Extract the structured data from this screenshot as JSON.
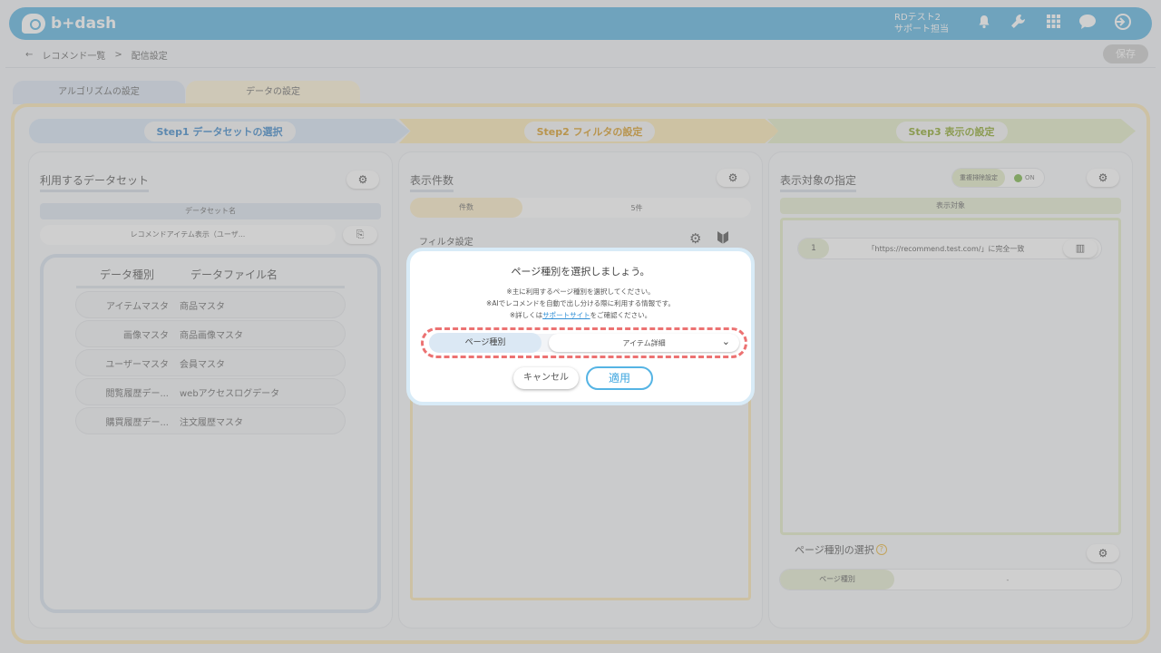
{
  "header": {
    "logo_text": "b+dash",
    "user_line1": "RDテスト2",
    "user_line2": "サポート担当",
    "icons": [
      "bell-icon",
      "wrench-icon",
      "grid-icon",
      "chat-icon",
      "logout-icon"
    ]
  },
  "breadcrumb": {
    "back": "←",
    "item1": "レコメンド一覧",
    "sep": ">",
    "item2": "配信設定"
  },
  "save_label": "保存",
  "tabs": {
    "algorithm": "アルゴリズムの設定",
    "data": "データの設定"
  },
  "steps": {
    "step1": "Step1 データセットの選択",
    "step2": "Step2 フィルタの設定",
    "step3": "Step3 表示の設定"
  },
  "dataset_panel": {
    "title": "利用するデータセット",
    "name_header": "データセット名",
    "name_value": "レコメンドアイテム表示（ユーザ...",
    "table_head_type": "データ種別",
    "table_head_file": "データファイル名",
    "rows": [
      {
        "type": "アイテムマスタ",
        "file": "商品マスタ"
      },
      {
        "type": "画像マスタ",
        "file": "商品画像マスタ"
      },
      {
        "type": "ユーザーマスタ",
        "file": "会員マスタ"
      },
      {
        "type": "閲覧履歴デー...",
        "file": "webアクセスログデータ"
      },
      {
        "type": "購買履歴デー...",
        "file": "注文履歴マスタ"
      }
    ]
  },
  "display_panel": {
    "title": "表示件数",
    "count_key": "件数",
    "count_value": "5件",
    "filter_title": "フィルタ設定"
  },
  "target_panel": {
    "title": "表示対象の指定",
    "dedupe_label": "重複排除設定",
    "toggle_value": "ON",
    "target_header": "表示対象",
    "target_num": "1",
    "target_value": "「https://recommend.test.com/」に完全一致",
    "pagetype_title": "ページ種別の選択",
    "pagetype_key": "ページ種別",
    "pagetype_value": "-"
  },
  "modal": {
    "title": "ページ種別を選択しましょう。",
    "desc1": "※主に利用するページ種別を選択してください。",
    "desc2": "※AIでレコメンドを自動で出し分ける際に利用する情報です。",
    "desc3_pre": "※詳しくは",
    "desc3_link": "サポートサイト",
    "desc3_post": "をご確認ください。",
    "select_key": "ページ種別",
    "select_value": "アイテム詳細",
    "cancel": "キャンセル",
    "apply": "適用"
  },
  "colors": {
    "header_blue": "#5ab4e0",
    "step1": "#d7e5f4",
    "step2": "#fbe8b4",
    "step3": "#e3ecc7",
    "highlight_dash": "#ec7272",
    "apply_border": "#55b4e4"
  }
}
